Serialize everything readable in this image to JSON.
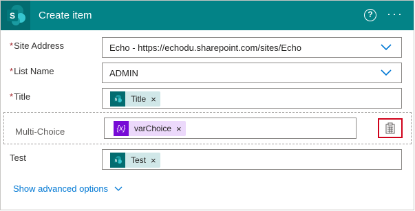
{
  "header": {
    "title": "Create item",
    "help_symbol": "?",
    "more_symbol": "···",
    "accent_color": "#038387",
    "logo_color": "#036c70",
    "icons": [
      "sharepoint-logo-icon",
      "help-icon",
      "more-options-icon"
    ]
  },
  "fields": {
    "site_address": {
      "required_mark": "*",
      "label": "Site Address",
      "value": "Echo - https://echodu.sharepoint.com/sites/Echo"
    },
    "list_name": {
      "required_mark": "*",
      "label": "List Name",
      "value": "ADMIN"
    },
    "title": {
      "required_mark": "*",
      "label": "Title",
      "token": {
        "label": "Title",
        "remove": "×",
        "icon": "sharepoint-icon"
      }
    },
    "multi_choice": {
      "label": "Multi-Choice",
      "token": {
        "icon_text": "{x}",
        "label": "varChoice",
        "remove": "×",
        "icon": "variable-icon"
      },
      "switch_icon": "switch-to-input-array-icon"
    },
    "test": {
      "label": "Test",
      "token": {
        "label": "Test",
        "remove": "×",
        "icon": "sharepoint-icon"
      }
    }
  },
  "advanced": {
    "label": "Show advanced options"
  },
  "colors": {
    "required": "#a4262c",
    "link": "#0078d4",
    "sp_token_bg": "#d0e7e8",
    "var_token_bg": "#ecd9fb",
    "var_icon_bg": "#770bd6",
    "highlight_border": "#d0021b"
  }
}
